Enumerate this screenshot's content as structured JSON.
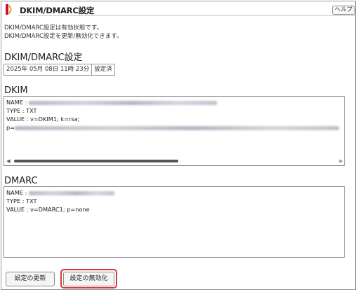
{
  "header": {
    "title": "DKIM/DMARC設定",
    "help_label": "ヘルプ"
  },
  "description": {
    "line1": "DKIM/DMARC設定は有効状態です。",
    "line2": "DKIM/DMARC設定を更新/無効化できます。"
  },
  "settings": {
    "heading": "DKIM/DMARC設定",
    "timestamp": "2025年 05月 08日 11時 23分",
    "status": "設定済"
  },
  "dkim": {
    "heading": "DKIM",
    "name_label": "NAME : ",
    "type_line": "TYPE : TXT",
    "value_line": "VALUE : v=DKIM1; k=rsa;",
    "p_label": "p="
  },
  "dmarc": {
    "heading": "DMARC",
    "name_label": "NAME : ",
    "type_line": "TYPE : TXT",
    "value_line": "VALUE : v=DMARC1; p=none"
  },
  "buttons": {
    "update": "設定の更新",
    "disable": "設定の無効化"
  },
  "colors": {
    "logo_red": "#c8102e",
    "logo_orange": "#f39800",
    "highlight": "#d43a3a"
  }
}
